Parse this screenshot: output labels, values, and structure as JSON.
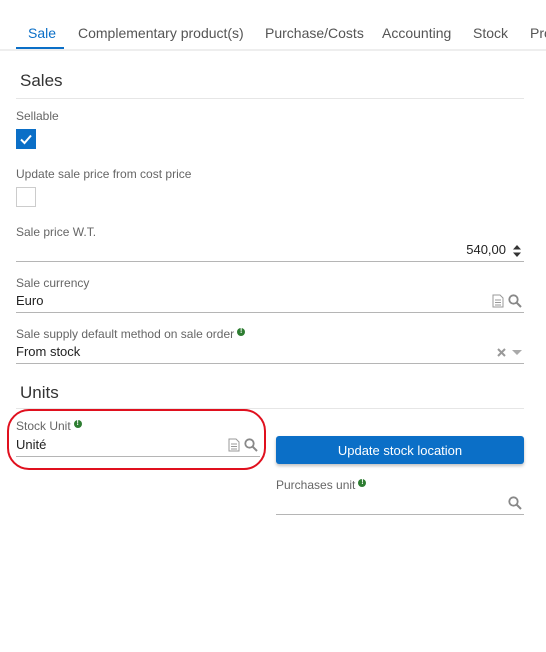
{
  "tabs": [
    {
      "label": "Sale",
      "active": true
    },
    {
      "label": "Complementary product(s)",
      "active": false
    },
    {
      "label": "Purchase/Costs",
      "active": false
    },
    {
      "label": "Accounting",
      "active": false
    },
    {
      "label": "Stock",
      "active": false
    },
    {
      "label": "Pro",
      "active": false
    }
  ],
  "sales": {
    "title": "Sales",
    "sellable": {
      "label": "Sellable",
      "checked": true
    },
    "update_sale_price": {
      "label": "Update sale price from cost price",
      "checked": false
    },
    "sale_price": {
      "label": "Sale price W.T.",
      "value": "540,00"
    },
    "sale_currency": {
      "label": "Sale currency",
      "value": "Euro"
    },
    "supply_method": {
      "label": "Sale supply default method on sale order",
      "value": "From stock"
    }
  },
  "units": {
    "title": "Units",
    "stock_unit": {
      "label": "Stock Unit",
      "value": "Unité"
    },
    "update_stock_location_label": "Update stock location",
    "purchases_unit": {
      "label": "Purchases unit",
      "value": ""
    }
  },
  "icons": {
    "info_glyph": "!"
  },
  "colors": {
    "accent": "#0b6fc7",
    "info": "#2e7d32",
    "highlight": "#e0101e"
  }
}
